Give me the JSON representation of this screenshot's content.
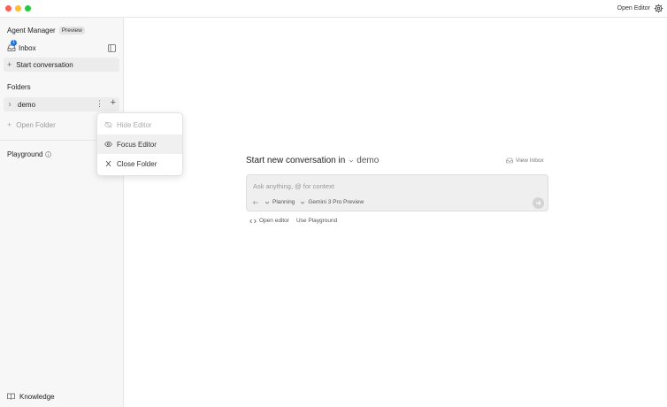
{
  "titlebar": {
    "open_editor_label": "Open Editor"
  },
  "sidebar": {
    "title": "Agent Manager",
    "title_badge": "Preview",
    "inbox_label": "Inbox",
    "inbox_count": "1",
    "start_conversation_label": "Start conversation",
    "folders_label": "Folders",
    "folders": [
      {
        "name": "demo"
      }
    ],
    "open_folder_label": "Open Folder",
    "playground_label": "Playground",
    "knowledge_label": "Knowledge"
  },
  "context_menu": {
    "items": [
      {
        "label": "Hide Editor",
        "icon": "eye-off-icon",
        "disabled": true
      },
      {
        "label": "Focus Editor",
        "icon": "eye-icon",
        "disabled": false
      },
      {
        "label": "Close Folder",
        "icon": "close-icon",
        "disabled": false
      }
    ]
  },
  "main": {
    "heading": "Start new conversation in",
    "workspace": "demo",
    "view_inbox_label": "View Inbox",
    "input_placeholder": "Ask anything, @ for context",
    "mode_label": "Planning",
    "model_label": "Gemini 3 Pro Preview",
    "open_editor_link": "Open editor",
    "use_playground_link": "Use Playground"
  },
  "colors": {
    "accent": "#1a73e8",
    "sidebar_bg": "#f7f7f7",
    "traffic_red": "#fe5f57",
    "traffic_yellow": "#febc2e",
    "traffic_green": "#28c840"
  }
}
